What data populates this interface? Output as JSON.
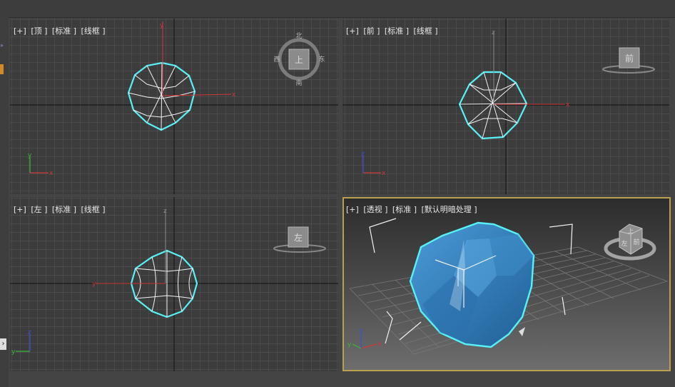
{
  "viewports": [
    {
      "id": "top",
      "labels": [
        "[+]",
        "[顶 ]",
        "[标准 ]",
        "[线框 ]"
      ],
      "cube_label": "上",
      "compass": {
        "n": "北",
        "s": "南",
        "w": "西",
        "e": "东"
      }
    },
    {
      "id": "front",
      "labels": [
        "[+]",
        "[前 ]",
        "[标准 ]",
        "[线框 ]"
      ],
      "cube_label": "前"
    },
    {
      "id": "left",
      "labels": [
        "[+]",
        "[左 ]",
        "[标准 ]",
        "[线框 ]"
      ],
      "cube_label": "左"
    },
    {
      "id": "perspective",
      "labels": [
        "[+]",
        "[透视 ]",
        "[标准 ]",
        "[默认明暗处理 ]"
      ],
      "cube_labels": [
        "左",
        "前",
        "上"
      ],
      "active": true
    }
  ],
  "axis_letters": {
    "x": "x",
    "y": "y",
    "z": "z"
  },
  "colors": {
    "grid_bg": "#3c3c3c",
    "grid_line": "#5a5a5a",
    "axis_main": "#1a1a1a",
    "selection": "#57f1f6",
    "wire": "#f2f2f2",
    "x_axis": "#d13838",
    "y_axis": "#38b838",
    "z_axis": "#3c50e0",
    "object_fill": "#3a86c6",
    "active_border": "#b9a04e"
  }
}
